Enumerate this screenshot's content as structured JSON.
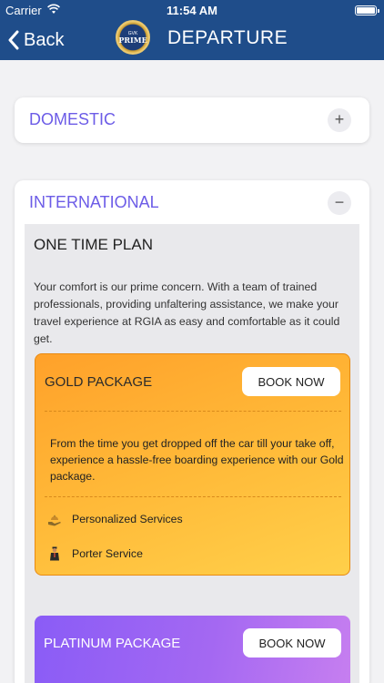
{
  "status_bar": {
    "carrier": "Carrier",
    "time": "11:54 AM"
  },
  "nav": {
    "back_label": "Back",
    "title": "DEPARTURE",
    "logo_small": "GVK",
    "logo_big": "PRIME"
  },
  "accordions": {
    "domestic": {
      "title": "DOMESTIC",
      "toggle": "+"
    },
    "international": {
      "title": "INTERNATIONAL",
      "toggle": "−"
    }
  },
  "plan": {
    "title": "ONE TIME PLAN",
    "description": "Your comfort is our prime concern. With a team of trained professionals, providing unfaltering assistance, we make your travel experience at RGIA as easy and comfortable as it could get."
  },
  "packages": [
    {
      "name": "GOLD PACKAGE",
      "button": "BOOK NOW",
      "description": "From the time you get dropped off the car till your take off, experience a hassle-free boarding experience with our Gold package.",
      "features": [
        {
          "label": "Personalized Services",
          "icon": "service-hand-icon"
        },
        {
          "label": "Porter Service",
          "icon": "porter-icon"
        }
      ]
    },
    {
      "name": "PLATINUM PACKAGE",
      "button": "BOOK NOW"
    }
  ],
  "colors": {
    "nav_bg": "#1f4d8a",
    "accent": "#6c5ce7",
    "gold": "#ffb938",
    "platinum": "#a468f2"
  }
}
